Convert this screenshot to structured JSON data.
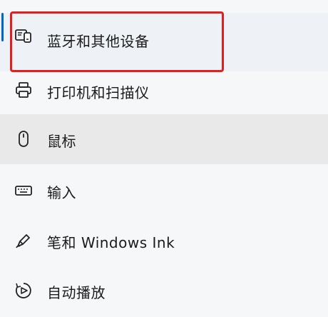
{
  "nav": {
    "items": [
      {
        "key": "bluetooth",
        "label": "蓝牙和其他设备",
        "icon": "bluetooth-devices-icon",
        "selected": true
      },
      {
        "key": "printers",
        "label": "打印机和扫描仪",
        "icon": "printer-icon"
      },
      {
        "key": "mouse",
        "label": "鼠标",
        "icon": "mouse-icon",
        "hovered": true
      },
      {
        "key": "typing",
        "label": "输入",
        "icon": "keyboard-icon"
      },
      {
        "key": "pen",
        "label": "笔和 Windows Ink",
        "icon": "pen-icon"
      },
      {
        "key": "autoplay",
        "label": "自动播放",
        "icon": "autoplay-icon"
      }
    ]
  },
  "colors": {
    "accent": "#0067c0",
    "highlight_box": "#e02020",
    "hover_bg": "#e9e9ea",
    "selected_bg": "#eef2f7"
  }
}
